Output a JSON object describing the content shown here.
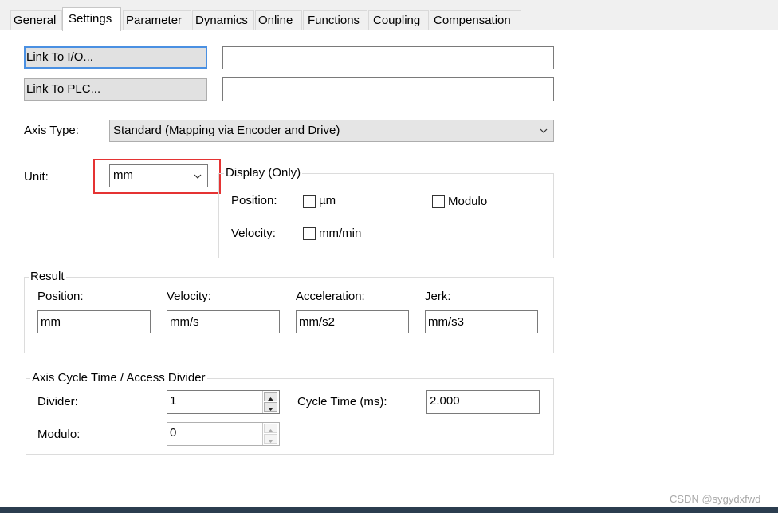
{
  "tabs": [
    {
      "label": "General",
      "active": false
    },
    {
      "label": "Settings",
      "active": true
    },
    {
      "label": "Parameter",
      "active": false
    },
    {
      "label": "Dynamics",
      "active": false
    },
    {
      "label": "Online",
      "active": false
    },
    {
      "label": "Functions",
      "active": false
    },
    {
      "label": "Coupling",
      "active": false
    },
    {
      "label": "Compensation",
      "active": false
    }
  ],
  "links": {
    "io_label": "Link To I/O...",
    "io_value": "",
    "plc_label": "Link To PLC...",
    "plc_value": ""
  },
  "axis_type": {
    "label": "Axis Type:",
    "value": "Standard (Mapping via Encoder and Drive)"
  },
  "unit": {
    "label": "Unit:",
    "value": "mm"
  },
  "display": {
    "title": "Display (Only)",
    "position_label": "Position:",
    "position_option": "µm",
    "position_checked": false,
    "velocity_label": "Velocity:",
    "velocity_option": "mm/min",
    "velocity_checked": false,
    "modulo_label": "Modulo",
    "modulo_checked": false
  },
  "result": {
    "title": "Result",
    "fields": [
      {
        "label": "Position:",
        "value": "mm"
      },
      {
        "label": "Velocity:",
        "value": "mm/s"
      },
      {
        "label": "Acceleration:",
        "value": "mm/s2"
      },
      {
        "label": "Jerk:",
        "value": "mm/s3"
      }
    ]
  },
  "cycle": {
    "title": "Axis Cycle Time / Access Divider",
    "divider_label": "Divider:",
    "divider_value": "1",
    "modulo_label": "Modulo:",
    "modulo_value": "0",
    "cycle_time_label": "Cycle Time (ms):",
    "cycle_time_value": "2.000"
  },
  "watermark": "CSDN @sygydxfwd",
  "colors": {
    "highlight_box": "#e53333",
    "focus_border": "#4a90e2",
    "bottom_bar": "#2b3d4f"
  },
  "icons": {
    "dropdown": "chevron-down-icon",
    "spin_up": "spin-up-icon",
    "spin_down": "spin-down-icon"
  }
}
